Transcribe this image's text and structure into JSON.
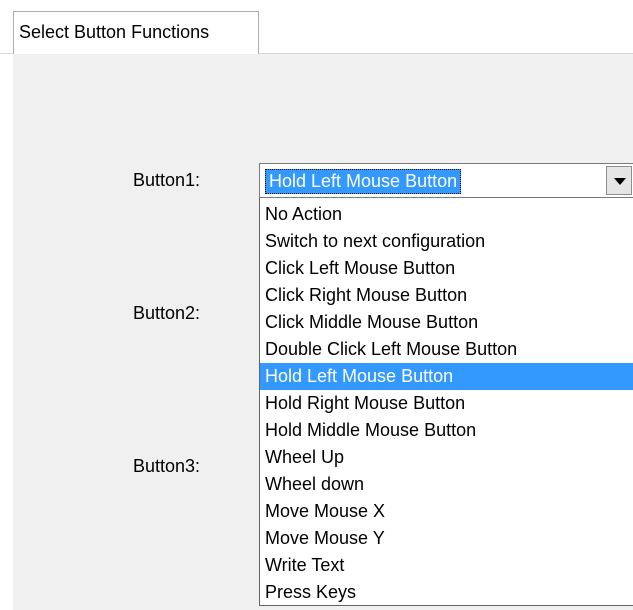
{
  "tabs": [
    {
      "label": "Select Button Functions",
      "active": true
    }
  ],
  "form": {
    "button1_label": "Button1:",
    "button2_label": "Button2:",
    "button3_label": "Button3:"
  },
  "combo": {
    "selected_value": "Hold Left Mouse Button",
    "expanded": true,
    "options": [
      "No Action",
      "Switch to next configuration",
      "Click Left Mouse Button",
      "Click Right Mouse Button",
      "Click Middle Mouse Button",
      "Double Click Left Mouse Button",
      "Hold Left Mouse Button",
      "Hold Right Mouse Button",
      "Hold Middle Mouse Button",
      "Wheel Up",
      "Wheel down",
      "Move Mouse X",
      "Move Mouse Y",
      "Write Text",
      "Press Keys"
    ],
    "highlighted_index": 6
  },
  "colors": {
    "selection": "#3399ff",
    "panel_bg": "#f0f0f0"
  }
}
